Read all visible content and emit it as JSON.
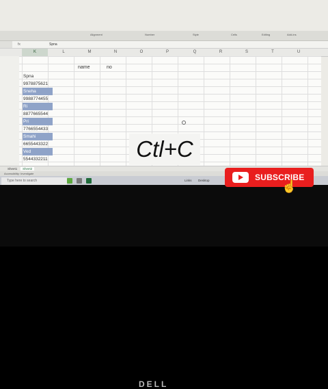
{
  "ribbon": {
    "groups": [
      "Alignment",
      "Number",
      "Style",
      "Cells",
      "Editing",
      "Add-ins"
    ]
  },
  "formula_bar": {
    "fx": "fx",
    "value": "Spna"
  },
  "columns": [
    "K",
    "L",
    "M",
    "N",
    "O",
    "P",
    "Q",
    "R",
    "S",
    "T",
    "U"
  ],
  "selected_column": "K",
  "header_cells": {
    "m": "name",
    "n": "no"
  },
  "cells_k": [
    {
      "text": "Spna",
      "highlight": false
    },
    {
      "text": "9978875621",
      "highlight": false
    },
    {
      "text": "Sneha",
      "highlight": true
    },
    {
      "text": "9988774455",
      "highlight": false
    },
    {
      "text": "Ri",
      "highlight": true
    },
    {
      "text": "8877665544",
      "highlight": false
    },
    {
      "text": "Pri",
      "highlight": true
    },
    {
      "text": "7766554433",
      "highlight": false
    },
    {
      "text": "Smahi",
      "highlight": true
    },
    {
      "text": "6655443322",
      "highlight": false
    },
    {
      "text": "Ved",
      "highlight": true
    },
    {
      "text": "5544332211",
      "highlight": false
    }
  ],
  "sheet_tabs": [
    "Sheet1",
    "Sheet2"
  ],
  "active_tab": "Sheet2",
  "status": {
    "accessibility": "Accessibility: Investigate"
  },
  "taskbar": {
    "search_placeholder": "Type here to search",
    "tray_left": "Links",
    "tray_mid": "Desktop"
  },
  "overlay_text": "Ctl+C",
  "subscribe": {
    "label": "SUBSCRIBE"
  },
  "brand": "DELL",
  "colors": {
    "accent_red": "#e91e1e",
    "selection_blue": "#8fa3c8",
    "excel_green": "#1f6b3a"
  }
}
